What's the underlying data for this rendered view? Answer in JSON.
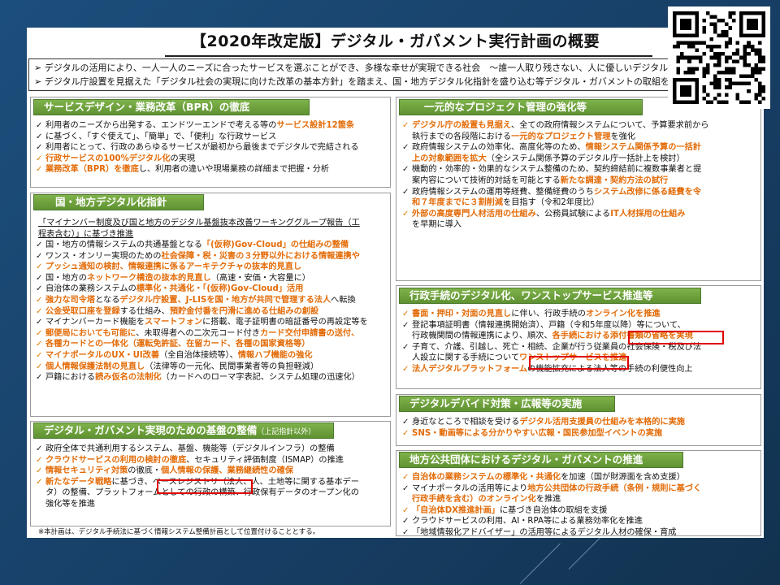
{
  "title": "【2020年改定版】デジタル・ガバメント実行計画の概要",
  "intro": [
    "➢ デジタルの活用により、一人一人のニーズに合ったサービスを選ぶことができ、多様な幸せが実現できる社会　～誰一人取り残さない、人に優しいデジタル化～",
    "➢ デジタル庁設置を見据えた「デジタル社会の実現に向けた改革の基本方針」を踏まえ、国・地方デジタル化指針を盛り込む等デジタル・ガバメントの取組を加速"
  ],
  "colors": {
    "accent": "#e36c09",
    "header": "#6fa33d",
    "redbox": "#e00000"
  },
  "bpr": {
    "head": "サービスデザイン・業務改革（BPR）の徹底",
    "items": [
      {
        "a": "利用者のニーズから出発する、エンドツーエンドで考える等の",
        "h": "サービス設計12箇条",
        "b": ""
      },
      {
        "a": "に基づく、「すぐ使えて」、「簡単」で、「便利」な行政サービス",
        "h": "",
        "b": ""
      },
      {
        "a": "利用者にとって、行政のあらゆるサービスが最初から最後までデジタルで完結される",
        "h": "",
        "b": ""
      },
      {
        "a": "",
        "h": "行政サービスの100%デジタル化",
        "b": "の実現"
      },
      {
        "a": "",
        "h": "業務改革（BPR）を徹底",
        "b": "し、利用者の違いや現場業務の詳細まで把握・分析"
      }
    ]
  },
  "kuni": {
    "head": "国・地方デジタル化指針",
    "lead1": "「マイナンバー制度及び国と地方のデジタル基盤抜本改善ワーキンググループ報告（工",
    "lead2": "程表含む）」に基づき推進",
    "items": [
      {
        "a": "国・地方の情報システムの共通基盤となる",
        "h": "「(仮称)Gov-Cloud」の仕組みの整備",
        "b": ""
      },
      {
        "a": "ワンス・オンリー実現のための",
        "h": "社会保障・税・災害の３分野以外における情報連携や",
        "b": ""
      },
      {
        "a": "",
        "h": "プッシュ通知の検討、情報連携に係るアーキテクチャの抜本的見直し",
        "b": ""
      },
      {
        "a": "国・地方の",
        "h": "ネットワーク構造の抜本的見直し",
        "b": "（高速・安価・大容量に）"
      },
      {
        "a": "自治体の業務システムの",
        "h": "標準化・共通化・「(仮称)Gov-Cloud」活用",
        "b": ""
      },
      {
        "a": "",
        "h": "強力な司令塔",
        "b": "となる",
        "h2": "デジタル庁設置、J-LISを国・地方が共同で管理する法人",
        "c": "へ転換"
      },
      {
        "a": "",
        "h": "公金受取口座を登録",
        "b": "する仕組み、",
        "h2": "預貯金付番を円滑に進める仕組みの創設",
        "c": ""
      },
      {
        "a": "マイナンバーカード機能を",
        "h": "スマートフォン",
        "b": "に搭載、電子証明書の暗証番号の再設定等を"
      },
      {
        "a": "",
        "h": "郵便局においても可能に",
        "b": "、未取得者への二次元コード付き",
        "h2": "カード交付申請書の送付、",
        "c": ""
      },
      {
        "a": "",
        "h": "各種カードとの一体化（運転免許証、在留カード、各種の国家資格等）",
        "b": ""
      },
      {
        "a": "",
        "h": "マイナポータルのUX・UI改善",
        "b": "（全自治体接続等）、",
        "h2": "情報ハブ機能の強化",
        "c": ""
      },
      {
        "a": "",
        "h": "個人情報保護法制の見直し",
        "b": "（法律等の一元化、民間事業者等の負担軽減）"
      },
      {
        "a": "戸籍における",
        "h": "読み仮名の法制化",
        "b": "（カードへのローマ字表記、システム処理の迅速化）"
      }
    ]
  },
  "kiban": {
    "head": "デジタル・ガバメント実現のための基盤の整備",
    "head_small": "（上記指針以外）",
    "items": [
      {
        "a": "政府全体で共通利用するシステム、基盤、機能等（デジタルインフラ）の整備",
        "h": "",
        "b": ""
      },
      {
        "a": "",
        "h": "クラウドサービスの利用の検討の徹底",
        "b": "、セキュリティ評価制度（ISMAP）の推進"
      },
      {
        "a": "",
        "h": "情報セキュリティ対策",
        "b": "の徹底・",
        "h2": "個人情報の保護、業務継続性の確保",
        "c": ""
      },
      {
        "a": "",
        "h": "新たなデータ戦略",
        "b": "に基づき、ベースレジストリ（法人、人、土地等に関する基本デー"
      },
      {
        "a": "タ）の整備、プラットフォームとしての行政の構築、行政保有データのオープン化の",
        "h": "",
        "b": "",
        "cont": true
      },
      {
        "a": "強化等を推進",
        "h": "",
        "b": "",
        "cont": true
      }
    ],
    "note": "※本計画は、デジタル手続法に基づく情報システム整備計画として位置付けることとする。"
  },
  "project": {
    "head": "一元的なプロジェクト管理の強化等",
    "items": [
      {
        "a": "",
        "h": "デジタル庁の設置も見据え",
        "b": "、全ての政府情報システムについて、予算要求前から"
      },
      {
        "a": "執行までの各段階における",
        "h": "一元的なプロジェクト管理",
        "b": "を強化",
        "cont": true
      },
      {
        "a": "政府情報システムの効率化、高度化等のため、",
        "h": "情報システム関係予算の一括計",
        "b": ""
      },
      {
        "a": "",
        "h": "上の対象範囲を拡大",
        "b": "（全システム関係予算のデジタル庁一括計上を検討）",
        "cont": true
      },
      {
        "a": "機動的・効率的・効果的なシステム整備のため、契約締結前に複数事業者と提",
        "h": "",
        "b": ""
      },
      {
        "a": "案内容について技術的対話を可能とする",
        "h": "新たな調達・契約方法の試行",
        "b": "",
        "cont": true
      },
      {
        "a": "政府情報システムの運用等経費、整備経費のうち",
        "h": "システム改修に係る経費を令",
        "b": ""
      },
      {
        "a": "",
        "h": "和７年度までに３割削減",
        "b": "を目指す（令和2年度比）",
        "cont": true
      },
      {
        "a": "",
        "h": "外部の高度専門人材活用の仕組み",
        "b": "、公務員試験による",
        "h2": "IT人材採用の仕組み",
        "c": ""
      },
      {
        "a": "を早期に導入",
        "h": "",
        "b": "",
        "cont": true
      }
    ]
  },
  "tetsuzuki": {
    "head": "行政手続のデジタル化、ワンストップサービス推進等",
    "items": [
      {
        "a": "",
        "h": "書面・押印・対面の見直し",
        "b": "に伴い、行政手続の",
        "h2": "オンライン化を推進",
        "c": ""
      },
      {
        "a": "登記事項証明書（情報連携開始済）、戸籍（令和5年度以降）等について、",
        "h": "",
        "b": ""
      },
      {
        "a": "行政機関間の情報連携により、順次、",
        "h": "各手続における添付書類の省略を実現",
        "b": "",
        "cont": true
      },
      {
        "a": "子育て、介護、引越し、死亡・相続、企業が行う従業員の社会保険・税及び法",
        "h": "",
        "b": ""
      },
      {
        "a": "人設立に関する手続について",
        "h": "ワンストップサービスを推進",
        "b": "",
        "cont": true
      },
      {
        "a": "",
        "h": "法人デジタルプラットフォーム",
        "b": "の機能拡充による法人等の手続の利便性向上"
      }
    ]
  },
  "divide": {
    "head": "デジタルデバイド対策・広報等の実施",
    "items": [
      {
        "a": "身近なところで相談を受ける",
        "h": "デジタル活用支援員の仕組みを本格的に実施",
        "b": ""
      },
      {
        "a": "",
        "h": "SNS・動画等による分かりやすい広報・国民参加型イベントの実施",
        "b": ""
      }
    ]
  },
  "chiho": {
    "head": "地方公共団体におけるデジタル・ガバメントの推進",
    "items": [
      {
        "a": "",
        "h": "自治体の業務システムの標準化・共通化",
        "b": "を加速（国が財源面を含め支援）"
      },
      {
        "a": "マイナポータルの活用等により",
        "h": "地方公共団体の行政手続（条例・規則に基づく",
        "b": ""
      },
      {
        "a": "",
        "h": "行政手続を含む）のオンライン化",
        "b": "を推進",
        "cont": true
      },
      {
        "a": "",
        "h": "「自治体DX推進計画」",
        "b": "に基づき自治体の取組を支援"
      },
      {
        "a": "クラウドサービスの利用、AI・RPA等による業務効率化を推進",
        "h": "",
        "b": ""
      },
      {
        "a": "「地域情報化アドバイザー」の活用等によるデジタル人材の確保・育成",
        "h": "",
        "b": ""
      }
    ]
  }
}
